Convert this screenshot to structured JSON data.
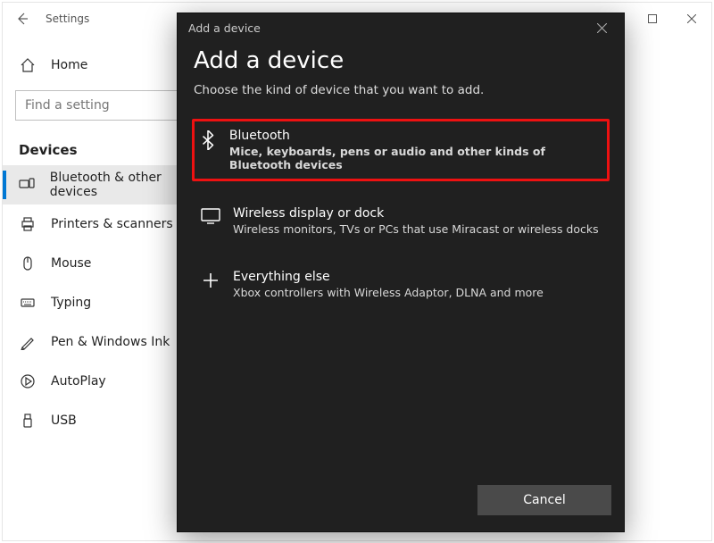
{
  "colors": {
    "accent": "#0078d4",
    "highlight_border": "#e11",
    "modal_bg": "#202020"
  },
  "window": {
    "title": "Settings"
  },
  "sidebar": {
    "home": "Home",
    "search_placeholder": "Find a setting",
    "section": "Devices",
    "items": [
      {
        "id": "bluetooth",
        "label": "Bluetooth & other devices",
        "selected": true
      },
      {
        "id": "printers",
        "label": "Printers & scanners"
      },
      {
        "id": "mouse",
        "label": "Mouse"
      },
      {
        "id": "typing",
        "label": "Typing"
      },
      {
        "id": "pen",
        "label": "Pen & Windows Ink"
      },
      {
        "id": "autoplay",
        "label": "AutoPlay"
      },
      {
        "id": "usb",
        "label": "USB"
      }
    ]
  },
  "modal": {
    "titlebar": "Add a device",
    "heading": "Add a device",
    "subtitle": "Choose the kind of device that you want to add.",
    "options": [
      {
        "id": "bluetooth",
        "title": "Bluetooth",
        "desc": "Mice, keyboards, pens or audio and other kinds of Bluetooth devices",
        "highlighted": true
      },
      {
        "id": "wireless",
        "title": "Wireless display or dock",
        "desc": "Wireless monitors, TVs or PCs that use Miracast or wireless docks"
      },
      {
        "id": "other",
        "title": "Everything else",
        "desc": "Xbox controllers with Wireless Adaptor, DLNA and more"
      }
    ],
    "cancel": "Cancel"
  }
}
